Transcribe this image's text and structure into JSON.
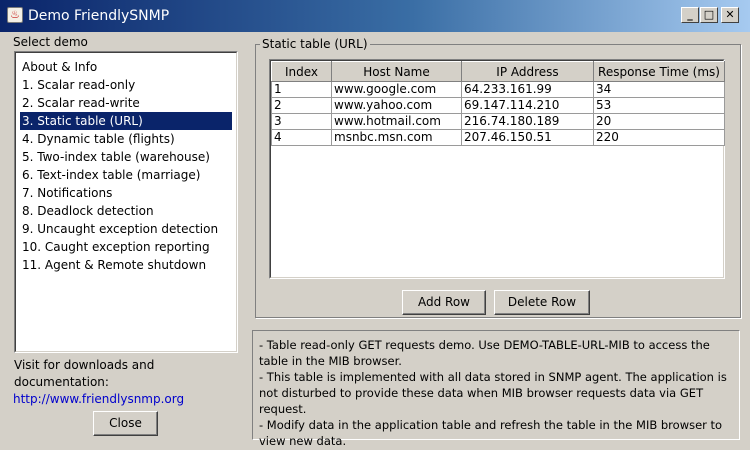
{
  "window": {
    "title": "Demo FriendlySNMP",
    "app_icon_glyph": "♨",
    "minimize_glyph": "_",
    "maximize_glyph": "□",
    "close_glyph": "✕"
  },
  "sidebar": {
    "heading": "Select demo",
    "items": [
      {
        "label": "About & Info"
      },
      {
        "label": "1. Scalar read-only"
      },
      {
        "label": "2. Scalar read-write"
      },
      {
        "label": "3. Static table (URL)",
        "selected": true
      },
      {
        "label": "4. Dynamic table (flights)"
      },
      {
        "label": "5. Two-index table (warehouse)"
      },
      {
        "label": "6. Text-index table (marriage)"
      },
      {
        "label": "7. Notifications"
      },
      {
        "label": "8. Deadlock detection"
      },
      {
        "label": "9. Uncaught exception detection"
      },
      {
        "label": "10. Caught exception reporting"
      },
      {
        "label": "11. Agent & Remote shutdown"
      }
    ],
    "visit_line1": "Visit for downloads and",
    "visit_line2": "documentation:",
    "link": "http://www.friendlysnmp.org",
    "close_label": "Close"
  },
  "main": {
    "group_title": "Static table (URL)",
    "table": {
      "columns": [
        "Index",
        "Host Name",
        "IP Address",
        "Response Time (ms)"
      ],
      "rows": [
        [
          "1",
          "www.google.com",
          "64.233.161.99",
          "34"
        ],
        [
          "2",
          "www.yahoo.com",
          "69.147.114.210",
          "53"
        ],
        [
          "3",
          "www.hotmail.com",
          "216.74.180.189",
          "20"
        ],
        [
          "4",
          "msnbc.msn.com",
          "207.46.150.51",
          "220"
        ]
      ]
    },
    "add_row_label": "Add Row",
    "delete_row_label": "Delete Row",
    "description": [
      " - Table read-only GET requests demo. Use DEMO-TABLE-URL-MIB to access the table in the MIB browser.",
      " - This table is implemented with all data stored in SNMP agent. The application is not disturbed to provide these data when MIB browser requests data via GET request.",
      " - Modify data in the application table and refresh the table in the MIB browser to view new data."
    ]
  },
  "colors": {
    "title_bar": "#0a246a",
    "selection": "#0a246a",
    "link": "#0000cc",
    "background": "#d4d0c8"
  }
}
